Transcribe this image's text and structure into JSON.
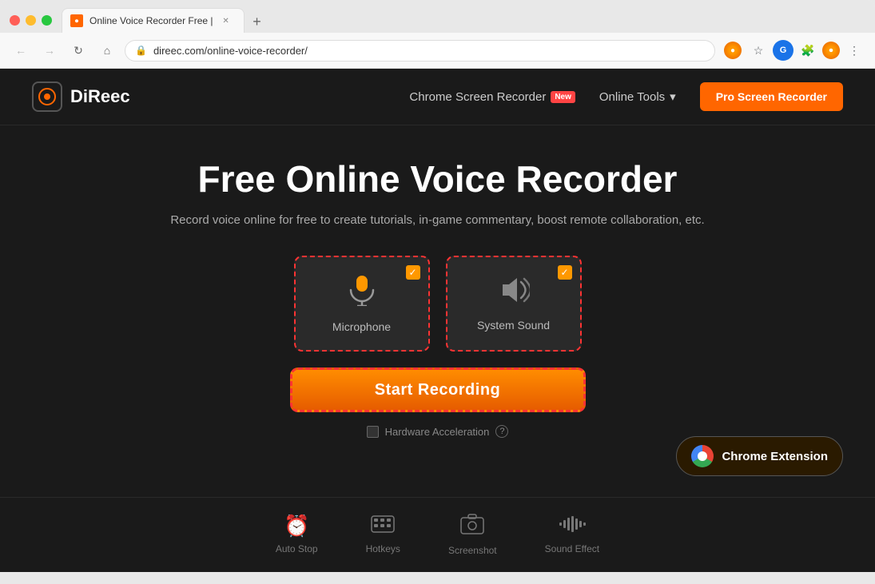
{
  "browser": {
    "tab_title": "Online Voice Recorder Free |",
    "tab_new_label": "+",
    "address_bar_url": "direec.com/online-voice-recorder/",
    "nav_back_label": "←",
    "nav_forward_label": "→",
    "nav_reload_label": "↻",
    "nav_home_label": "⌂"
  },
  "site": {
    "logo_text": "DiReec",
    "nav_screen_recorder": "Chrome Screen Recorder",
    "nav_new_badge": "New",
    "nav_online_tools": "Online Tools",
    "nav_pro_btn": "Pro Screen Recorder",
    "hero_title": "Free Online Voice Recorder",
    "hero_subtitle": "Record voice online for free to create tutorials, in-game commentary, boost remote collaboration, etc.",
    "option_microphone_label": "Microphone",
    "option_microphone_checked": "✓",
    "option_system_sound_label": "System Sound",
    "option_system_sound_checked": "✓",
    "start_recording_btn": "Start Recording",
    "hw_accel_label": "Hardware Acceleration",
    "hw_help_label": "?",
    "chrome_ext_label": "Chrome Extension",
    "bottom_icons": [
      {
        "icon": "⏰",
        "label": "Auto Stop"
      },
      {
        "icon": "⌨",
        "label": "Hotkeys"
      },
      {
        "icon": "📷",
        "label": "Screenshot"
      },
      {
        "icon": "📊",
        "label": "Sound Effect"
      }
    ]
  },
  "colors": {
    "brand_orange": "#ff6600",
    "accent_red": "#ff3333",
    "dark_bg": "#1a1a1a",
    "card_bg": "#2a2a2a"
  }
}
